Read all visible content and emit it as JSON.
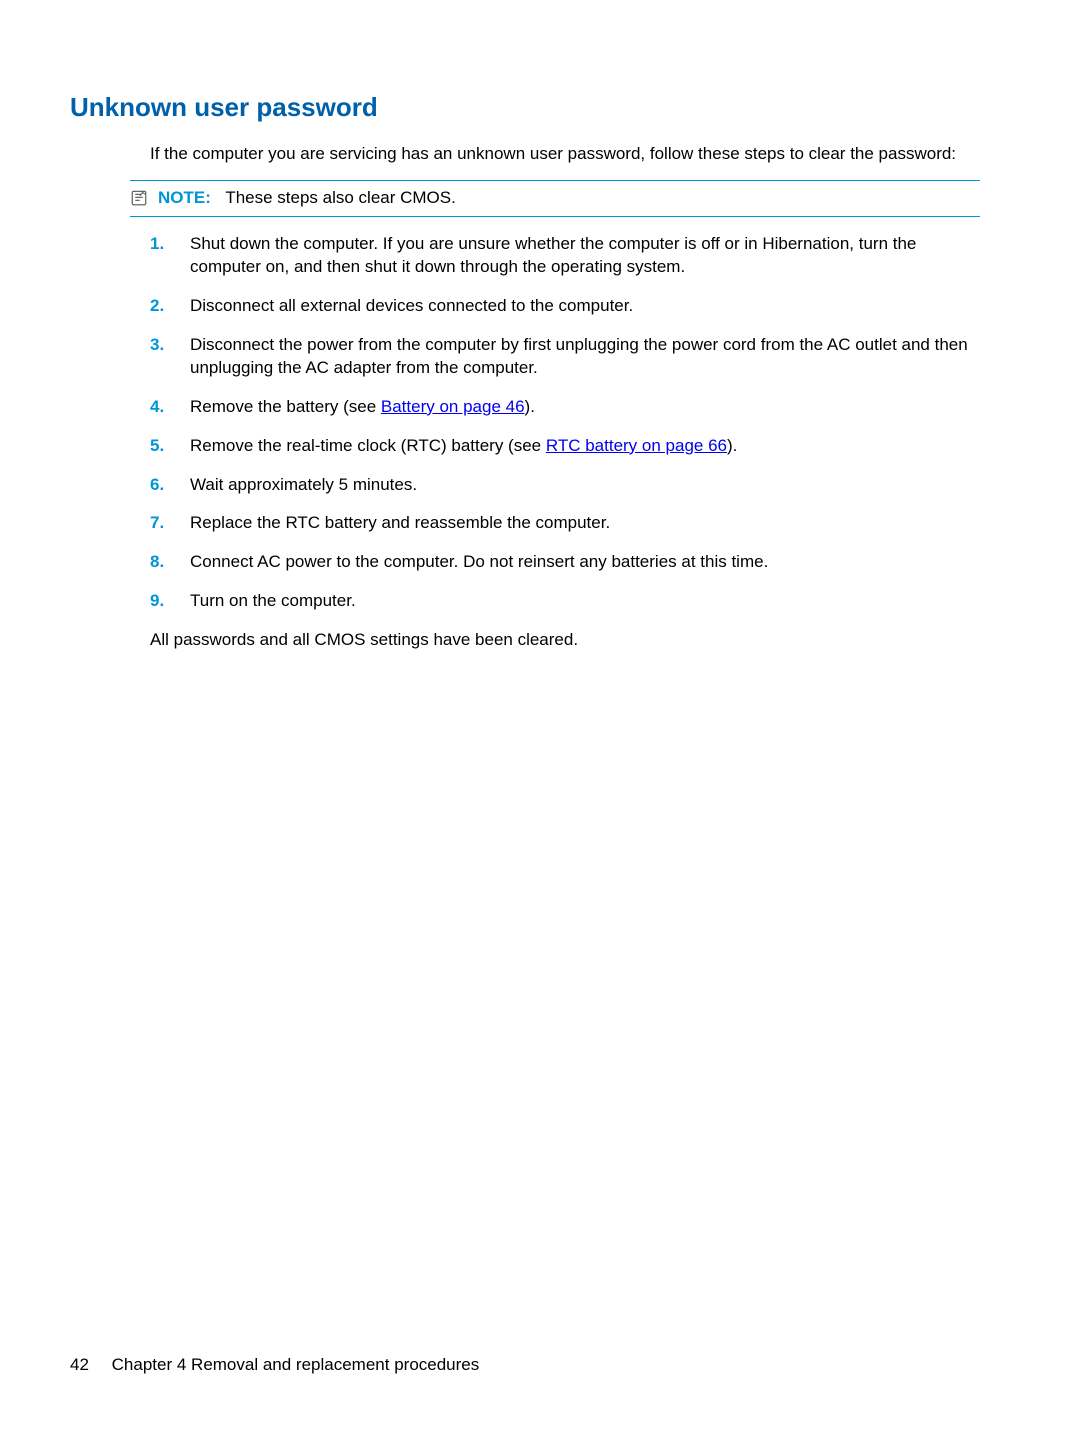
{
  "heading": "Unknown user password",
  "intro": "If the computer you are servicing has an unknown user password, follow these steps to clear the password:",
  "note": {
    "label": "NOTE:",
    "text": "These steps also clear CMOS."
  },
  "steps": {
    "s1": "Shut down the computer. If you are unsure whether the computer is off or in Hibernation, turn the computer on, and then shut it down through the operating system.",
    "s2": "Disconnect all external devices connected to the computer.",
    "s3": "Disconnect the power from the computer by first unplugging the power cord from the AC outlet and then unplugging the AC adapter from the computer.",
    "s4_pre": "Remove the battery (see ",
    "s4_link": "Battery on page 46",
    "s4_post": ").",
    "s5_pre": "Remove the real-time clock (RTC) battery (see ",
    "s5_link": "RTC battery on page 66",
    "s5_post": ").",
    "s6": "Wait approximately 5 minutes.",
    "s7": "Replace the RTC battery and reassemble the computer.",
    "s8": "Connect AC power to the computer. Do not reinsert any batteries at this time.",
    "s9": "Turn on the computer."
  },
  "numbers": {
    "n1": "1.",
    "n2": "2.",
    "n3": "3.",
    "n4": "4.",
    "n5": "5.",
    "n6": "6.",
    "n7": "7.",
    "n8": "8.",
    "n9": "9."
  },
  "closing": "All passwords and all CMOS settings have been cleared.",
  "footer": {
    "page_number": "42",
    "chapter": "Chapter 4   Removal and replacement procedures"
  }
}
